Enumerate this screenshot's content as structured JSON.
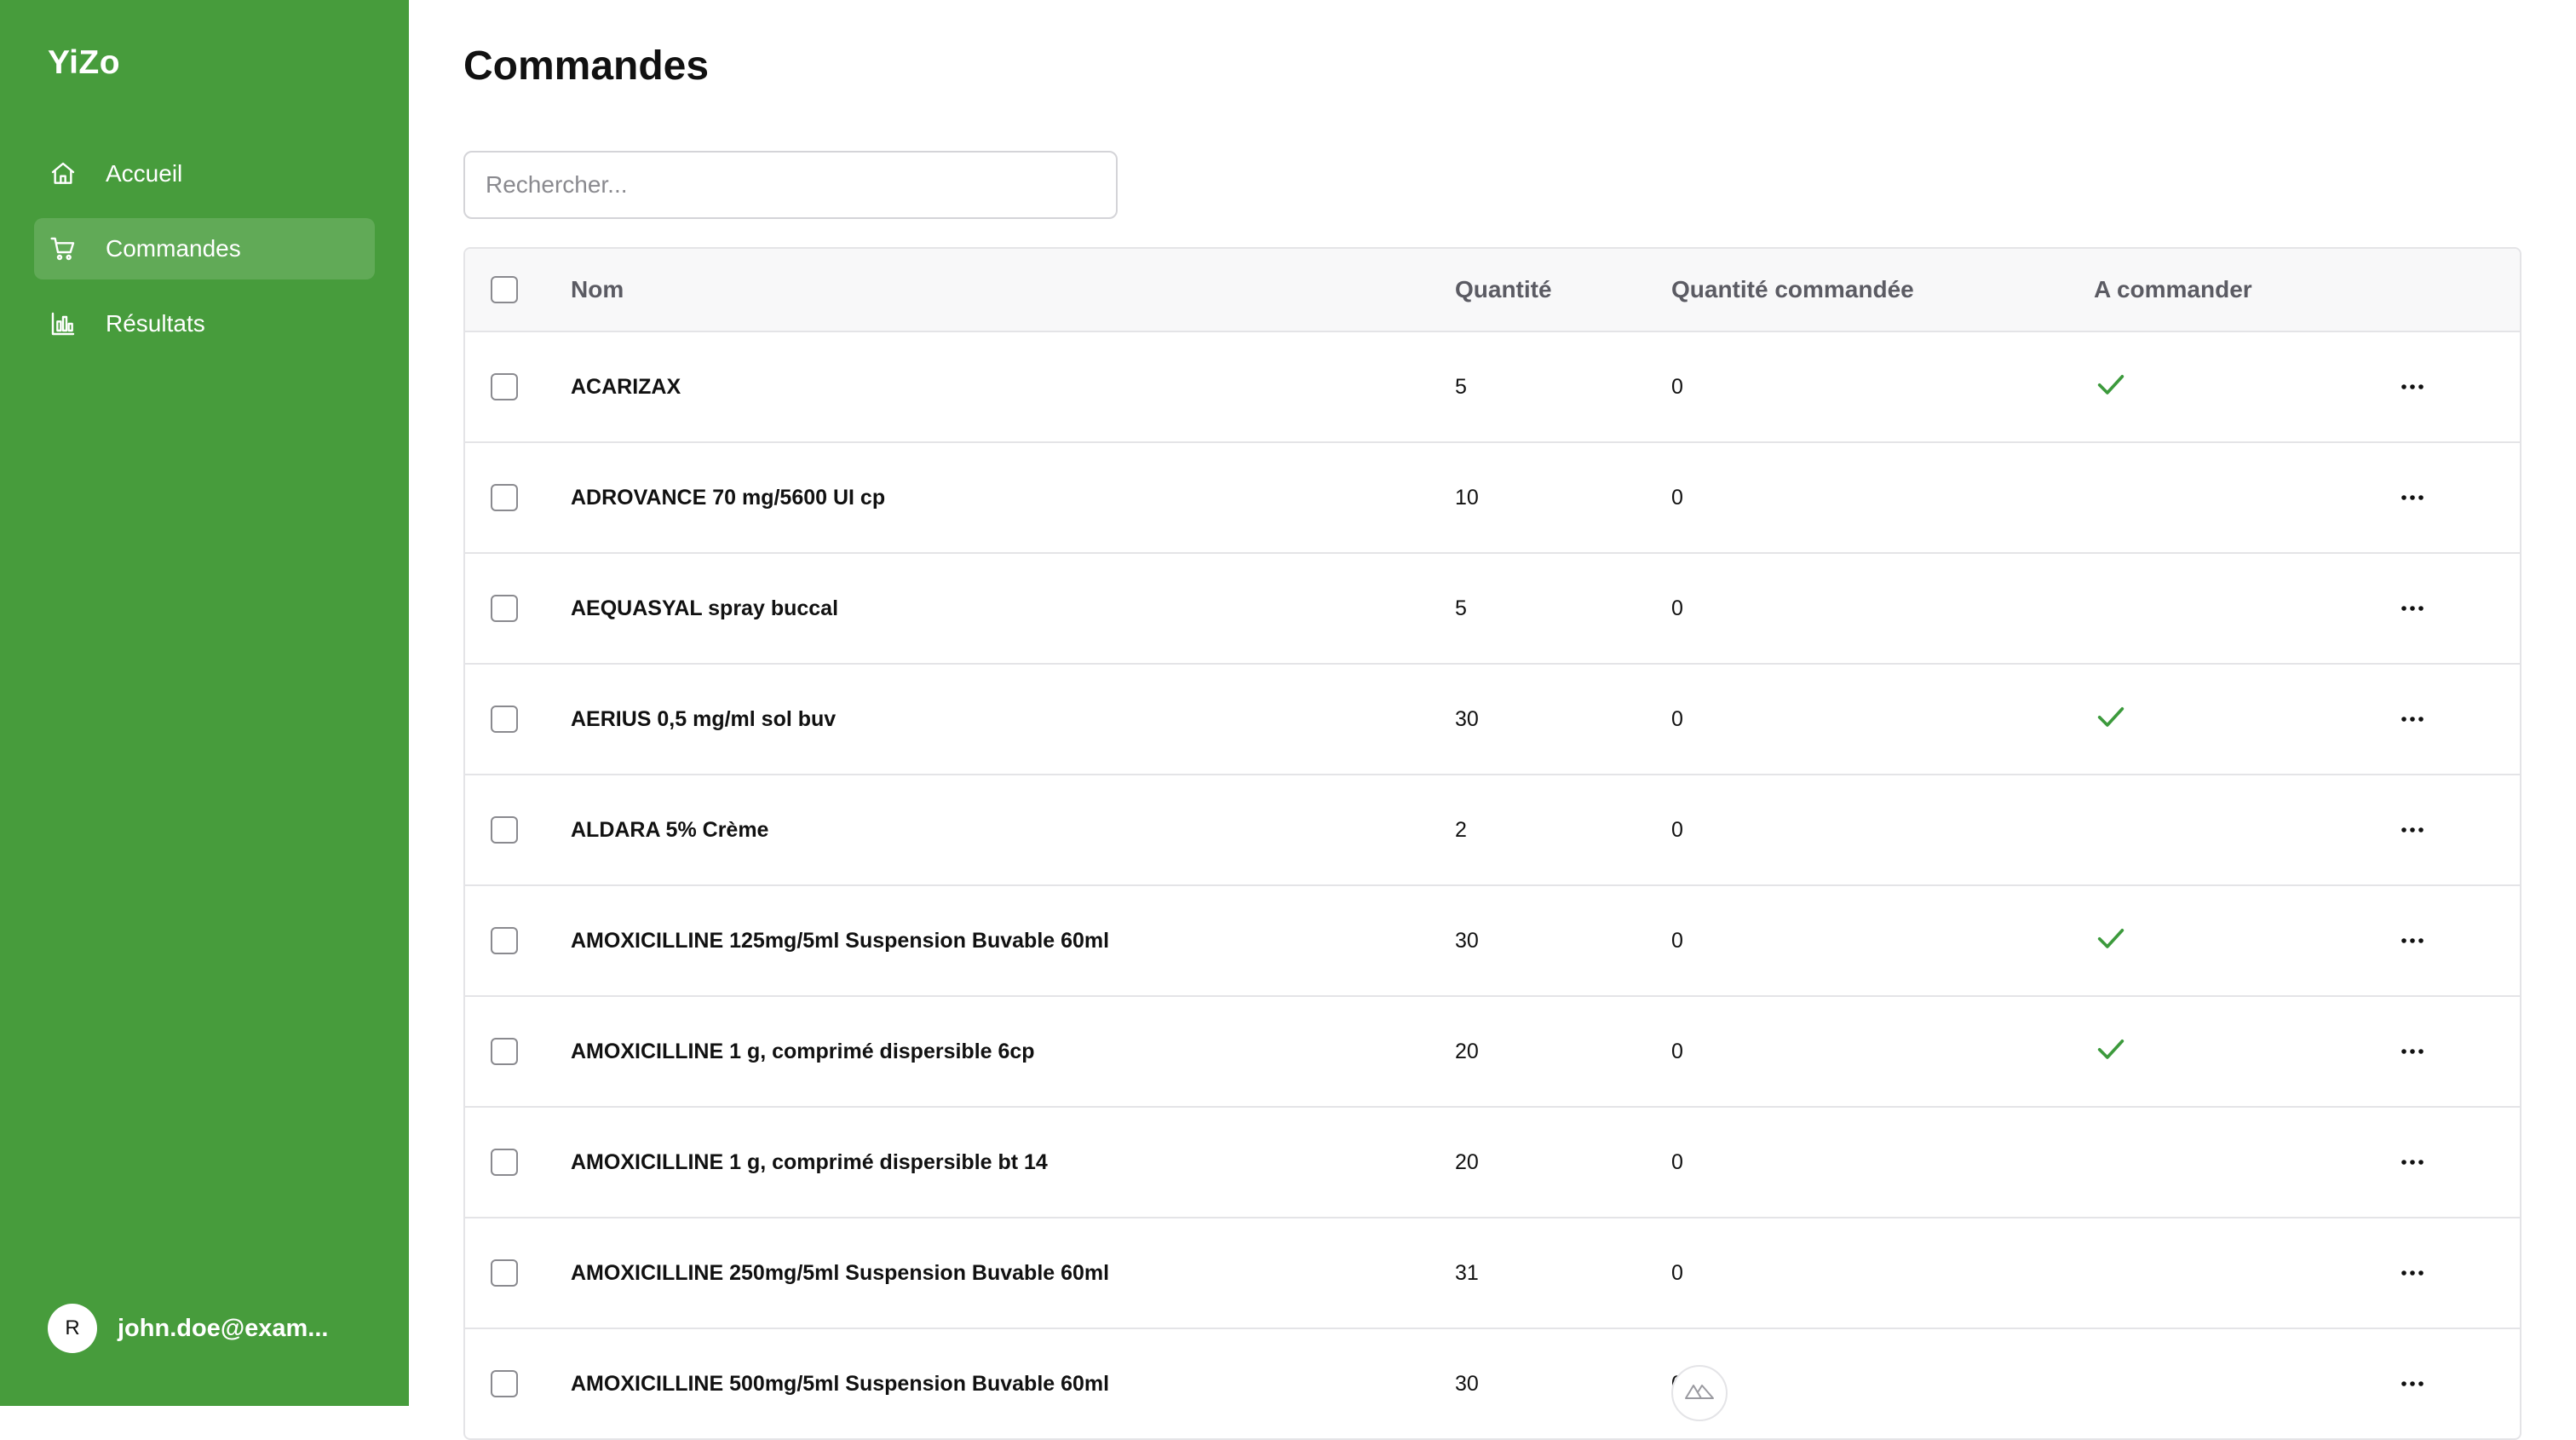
{
  "app": {
    "brand": "YiZo"
  },
  "sidebar": {
    "items": [
      {
        "label": "Accueil",
        "icon": "home-icon",
        "active": false
      },
      {
        "label": "Commandes",
        "icon": "cart-icon",
        "active": true
      },
      {
        "label": "Résultats",
        "icon": "bar-chart-icon",
        "active": false
      }
    ],
    "user": {
      "initial": "R",
      "email": "john.doe@exam..."
    }
  },
  "main": {
    "title": "Commandes",
    "search": {
      "placeholder": "Rechercher...",
      "value": ""
    },
    "table": {
      "columns": {
        "name": "Nom",
        "quantity": "Quantité",
        "ordered": "Quantité commandée",
        "to_order": "A commander"
      },
      "rows": [
        {
          "name": "ACARIZAX",
          "quantity": "5",
          "ordered": "0",
          "to_order": true
        },
        {
          "name": "ADROVANCE 70 mg/5600 UI cp",
          "quantity": "10",
          "ordered": "0",
          "to_order": false
        },
        {
          "name": "AEQUASYAL spray buccal",
          "quantity": "5",
          "ordered": "0",
          "to_order": false
        },
        {
          "name": "AERIUS 0,5 mg/ml sol buv",
          "quantity": "30",
          "ordered": "0",
          "to_order": true
        },
        {
          "name": "ALDARA 5% Crème",
          "quantity": "2",
          "ordered": "0",
          "to_order": false
        },
        {
          "name": "AMOXICILLINE 125mg/5ml Suspension Buvable 60ml",
          "quantity": "30",
          "ordered": "0",
          "to_order": true
        },
        {
          "name": "AMOXICILLINE 1 g, comprimé dispersible 6cp",
          "quantity": "20",
          "ordered": "0",
          "to_order": true
        },
        {
          "name": "AMOXICILLINE 1 g, comprimé dispersible bt 14",
          "quantity": "20",
          "ordered": "0",
          "to_order": false
        },
        {
          "name": "AMOXICILLINE 250mg/5ml Suspension Buvable 60ml",
          "quantity": "31",
          "ordered": "0",
          "to_order": false
        },
        {
          "name": "AMOXICILLINE 500mg/5ml Suspension Buvable 60ml",
          "quantity": "30",
          "ordered": "0",
          "to_order": false
        }
      ]
    }
  },
  "colors": {
    "sidebar_bg": "#479c3c",
    "check_green": "#3c9a3c",
    "header_bg": "#f8f8f9",
    "border": "#e4e4e7"
  }
}
